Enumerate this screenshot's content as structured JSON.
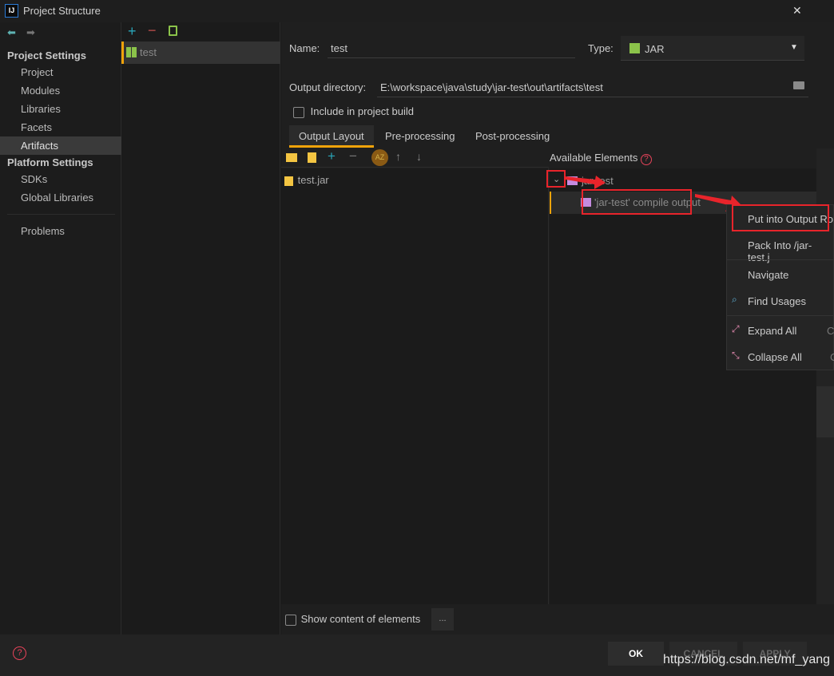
{
  "window": {
    "title": "Project Structure",
    "app_icon": "IJ",
    "close": "✕"
  },
  "sidebar": {
    "project_settings": "Project Settings",
    "items": [
      "Project",
      "Modules",
      "Libraries",
      "Facets",
      "Artifacts"
    ],
    "platform_settings": "Platform Settings",
    "platform_items": [
      "SDKs",
      "Global Libraries"
    ],
    "problems": "Problems",
    "selected": "Artifacts"
  },
  "artifact_list": {
    "items": [
      "test"
    ]
  },
  "form": {
    "name_label": "Name:",
    "name_value": "test",
    "type_label": "Type:",
    "type_value": "JAR",
    "output_dir_label": "Output directory:",
    "output_dir_value": "E:\\workspace\\java\\study\\jar-test\\out\\artifacts\\test",
    "include_label": "Include in project build",
    "include_checked": false
  },
  "tabs": [
    "Output Layout",
    "Pre-processing",
    "Post-processing"
  ],
  "layout_tree": {
    "items": [
      "test.jar"
    ]
  },
  "available": {
    "title": "Available Elements",
    "module": "jar-test",
    "child": "'jar-test' compile output"
  },
  "context_menu": {
    "items": [
      "Put into Output Ro",
      "Pack Into /jar-test.j",
      "Navigate",
      "Find Usages",
      "Expand All",
      "Collapse All"
    ],
    "shortcuts": [
      "Ct",
      "C"
    ]
  },
  "bottom": {
    "show_content_label": "Show content of elements",
    "show_content_checked": false,
    "more": "..."
  },
  "footer": {
    "ok": "OK",
    "cancel": "CANCEL",
    "apply": "APPLY",
    "watermark": "https://blog.csdn.net/mf_yang"
  },
  "colors": {
    "accent": "#f0a30a",
    "highlight": "#e8242b",
    "jar_green": "#8bc34a"
  }
}
